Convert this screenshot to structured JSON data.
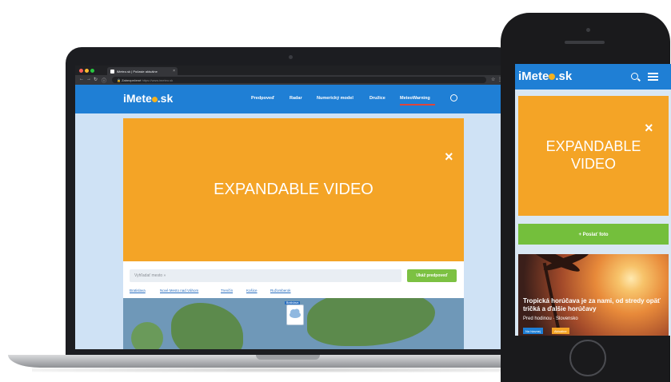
{
  "browser": {
    "tab_title": "iMeteo.sk | Počasie aktuálne",
    "tab_close": "×",
    "secure_label": "Zabezpečené",
    "url": "https://www.imeteo.sk"
  },
  "site": {
    "logo_pre": "iMete",
    "logo_post": ".sk",
    "nav": [
      "Predpoveď",
      "Radar",
      "Numerický model",
      "Družice",
      "MeteoWarning"
    ]
  },
  "ad": {
    "desktop_label": "EXPANDABLE VIDEO",
    "mobile_label_line1": "EXPANDABLE",
    "mobile_label_line2": "VIDEO",
    "close": "×"
  },
  "search": {
    "placeholder": "Vyhľadať mesto »",
    "button": "Ukáž predpoveď"
  },
  "cities": [
    "Bratislava",
    "Nové Mesto nad Váhom",
    "Trenčín",
    "Košice",
    "Ružomberok"
  ],
  "map": {
    "pin_label": "Bratislava"
  },
  "phone": {
    "green_bar_label": "+ Poslať foto",
    "news_title": "Tropická horúčava je za nami, od stredy opäť tričká a ďalšie horúčavy",
    "news_meta": "Pred hodinou · Slovensko",
    "tags": [
      "Na hlavnej",
      "Aktuálne"
    ]
  },
  "colors": {
    "header_blue": "#1f7fd5",
    "ad_orange": "#f4a426",
    "button_green": "#7cc142",
    "logo_sun": "#f5b21d"
  }
}
